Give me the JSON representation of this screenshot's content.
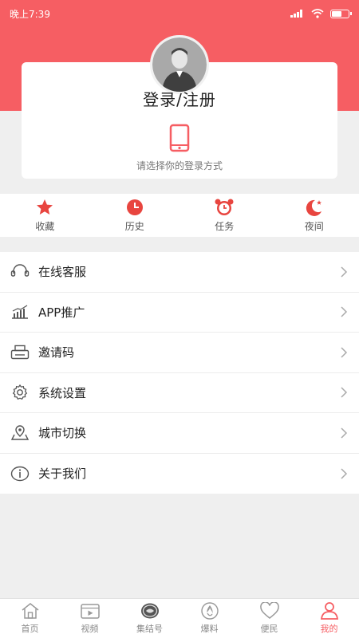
{
  "status_bar": {
    "time": "晚上7:39"
  },
  "login": {
    "title": "登录/注册",
    "hint": "请选择你的登录方式"
  },
  "quick_actions": [
    {
      "label": "收藏",
      "icon": "star-icon"
    },
    {
      "label": "历史",
      "icon": "clock-icon"
    },
    {
      "label": "任务",
      "icon": "alarm-icon"
    },
    {
      "label": "夜间",
      "icon": "moon-icon"
    }
  ],
  "menu": [
    {
      "label": "在线客服",
      "icon": "headset-icon"
    },
    {
      "label": "APP推广",
      "icon": "chart-icon"
    },
    {
      "label": "邀请码",
      "icon": "printer-icon"
    },
    {
      "label": "系统设置",
      "icon": "gear-icon"
    },
    {
      "label": "城市切换",
      "icon": "location-icon"
    },
    {
      "label": "关于我们",
      "icon": "info-icon"
    }
  ],
  "tabbar": [
    {
      "label": "首页",
      "icon": "home-icon"
    },
    {
      "label": "视频",
      "icon": "video-icon"
    },
    {
      "label": "集结号",
      "icon": "badge-icon"
    },
    {
      "label": "爆料",
      "icon": "fire-icon"
    },
    {
      "label": "便民",
      "icon": "heart-icon"
    },
    {
      "label": "我的",
      "icon": "user-icon",
      "active": true
    }
  ],
  "colors": {
    "accent": "#f65e63",
    "background": "#efefef"
  }
}
